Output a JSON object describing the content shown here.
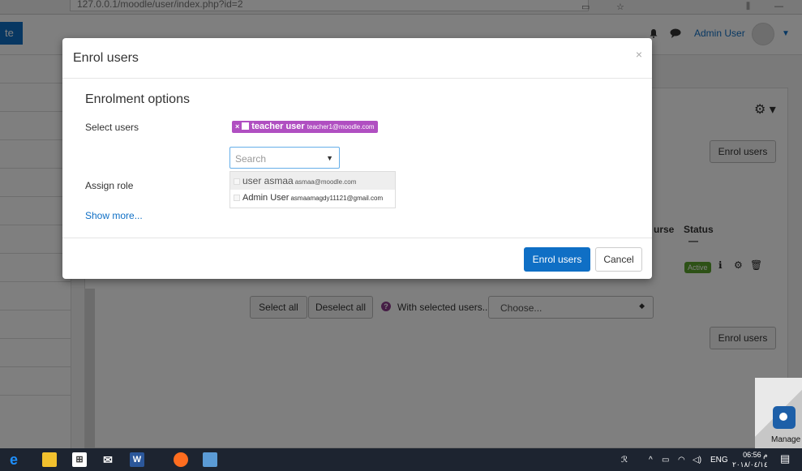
{
  "browser": {
    "url": "127.0.0.1/moodle/user/index.php?id=2"
  },
  "navbar": {
    "brand": "te",
    "user_name": "Admin User"
  },
  "page": {
    "enrol_users_top": "Enrol users",
    "enrol_users_bottom": "Enrol users",
    "column_course": "urse",
    "column_status": "Status",
    "status_dash": "—",
    "active_badge": "Active",
    "select_all": "Select all",
    "deselect_all": "Deselect all",
    "with_selected": "With selected users...",
    "bulk_choose": "Choose..."
  },
  "modal": {
    "title": "Enrol users",
    "close": "×",
    "legend": "Enrolment options",
    "select_users_label": "Select users",
    "assign_role_label": "Assign role",
    "show_more": "Show more...",
    "selected_chip": {
      "name": "teacher user",
      "email": "teacher1@moodle.com"
    },
    "search_placeholder": "Search",
    "suggestions": [
      {
        "name": "user asmaa",
        "email": "asmaa@moodle.com"
      },
      {
        "name": "Admin User",
        "email": "asmaamagdy11121@gmail.com"
      }
    ],
    "enrol_button": "Enrol users",
    "cancel_button": "Cancel"
  },
  "taskbar": {
    "lang": "ENG",
    "time": "06:56 م",
    "date": "٢٠١٨/٠٤/١٤"
  },
  "manage_widget": {
    "label": "Manage"
  }
}
